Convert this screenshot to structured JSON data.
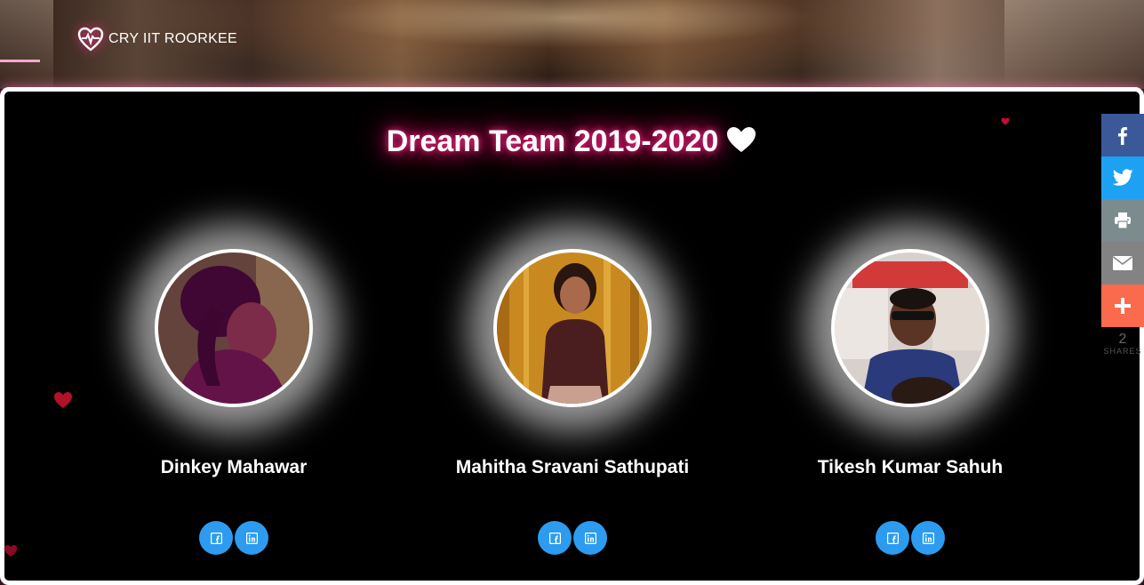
{
  "brand": {
    "name": "CRY IIT ROORKEE"
  },
  "section": {
    "title": "Dream Team 2019-2020"
  },
  "members": [
    {
      "name": "Dinkey Mahawar"
    },
    {
      "name": "Mahitha Sravani Sathupati"
    },
    {
      "name": "Tikesh Kumar Sahuh"
    }
  ],
  "share": {
    "count": "2",
    "label": "SHARES",
    "buttons": [
      "facebook",
      "twitter",
      "print",
      "email",
      "more"
    ],
    "colors": {
      "facebook": "#3b5998",
      "twitter": "#1da1f2",
      "print": "#7c8b8e",
      "email": "#838383",
      "more": "#fa6a4c"
    }
  },
  "colors": {
    "accent_pink": "#ff1477",
    "social_blue": "#2d9cf0"
  }
}
